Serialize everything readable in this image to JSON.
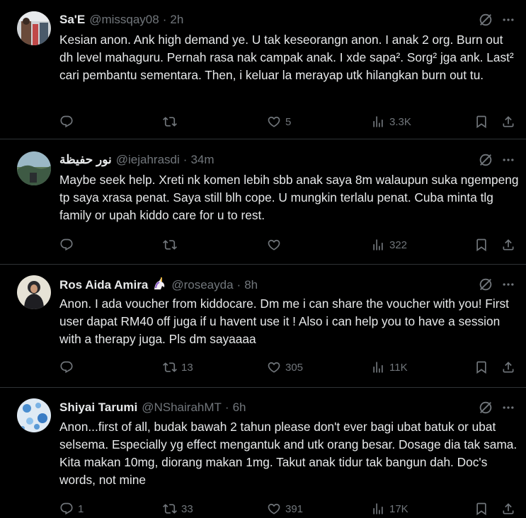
{
  "tweets": [
    {
      "name": "Sa'E",
      "handle": "@missqay08",
      "time": "2h",
      "text": "Kesian anon. Ank high demand ye. U tak keseorangn anon. I anak 2 org. Burn out dh level mahaguru. Pernah rasa nak campak anak.  I xde sapa². Sorg² jga ank. Last² cari pembantu sementara. Then, i keluar la merayap utk hilangkan burn out tu.",
      "replies": "",
      "reposts": "",
      "likes": "5",
      "views": "3.3K"
    },
    {
      "name": "نور حفيظة",
      "handle": "@iejahrasdi",
      "time": "34m",
      "text": "Maybe seek help. Xreti nk komen lebih sbb anak saya 8m walaupun suka ngempeng tp saya xrasa penat. Saya still blh cope. U mungkin terlalu penat. Cuba minta tlg family or upah kiddo care for u to rest.",
      "replies": "",
      "reposts": "",
      "likes": "",
      "views": "322"
    },
    {
      "name": "Ros Aida Amira",
      "handle": "@roseayda",
      "time": "8h",
      "text": "Anon. I ada voucher from kiddocare. Dm me i can share the voucher with you! First user dapat RM40 off juga if u havent use it ! Also i can help you to have a session with a therapy juga. Pls dm sayaaaa",
      "replies": "",
      "reposts": "13",
      "likes": "305",
      "views": "11K"
    },
    {
      "name": "Shiyai Tarumi",
      "handle": "@NShairahMT",
      "time": "6h",
      "text": "Anon...first of all, budak bawah 2 tahun please don't ever bagi ubat batuk or ubat selsema. Especially yg effect mengantuk and utk orang besar. Dosage dia tak sama. Kita makan 10mg, diorang makan 1mg. Takut anak tidur tak bangun dah. Doc's words, not mine",
      "replies": "1",
      "reposts": "33",
      "likes": "391",
      "views": "17K"
    }
  ],
  "icons": {
    "reply": "reply-icon",
    "repost": "repost-icon",
    "like": "heart-icon",
    "views": "views-icon",
    "bookmark": "bookmark-icon",
    "share": "share-icon",
    "grok": "grok-icon",
    "more": "more-icon"
  },
  "colors": {
    "background": "#000000",
    "text": "#e7e9ea",
    "muted": "#71767b",
    "divider": "#2f3336"
  }
}
